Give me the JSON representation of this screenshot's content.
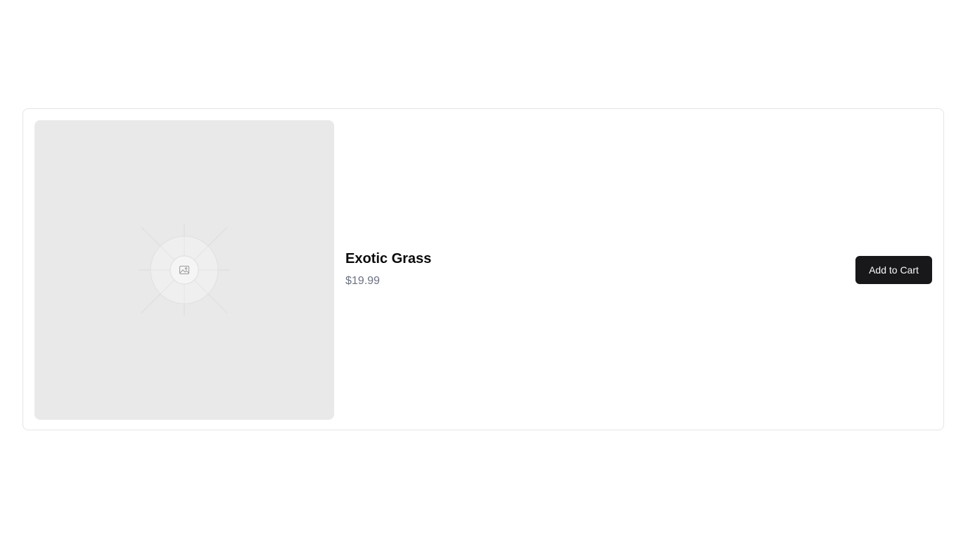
{
  "product": {
    "name": "Exotic Grass",
    "price": "$19.99",
    "image_icon": "image-placeholder-icon"
  },
  "actions": {
    "add_to_cart_label": "Add to Cart"
  },
  "colors": {
    "button_background": "#18181b",
    "button_text": "#fafafa",
    "price_text": "#6b7280",
    "image_background": "#e9e9e9",
    "card_border": "#e5e5e5"
  }
}
